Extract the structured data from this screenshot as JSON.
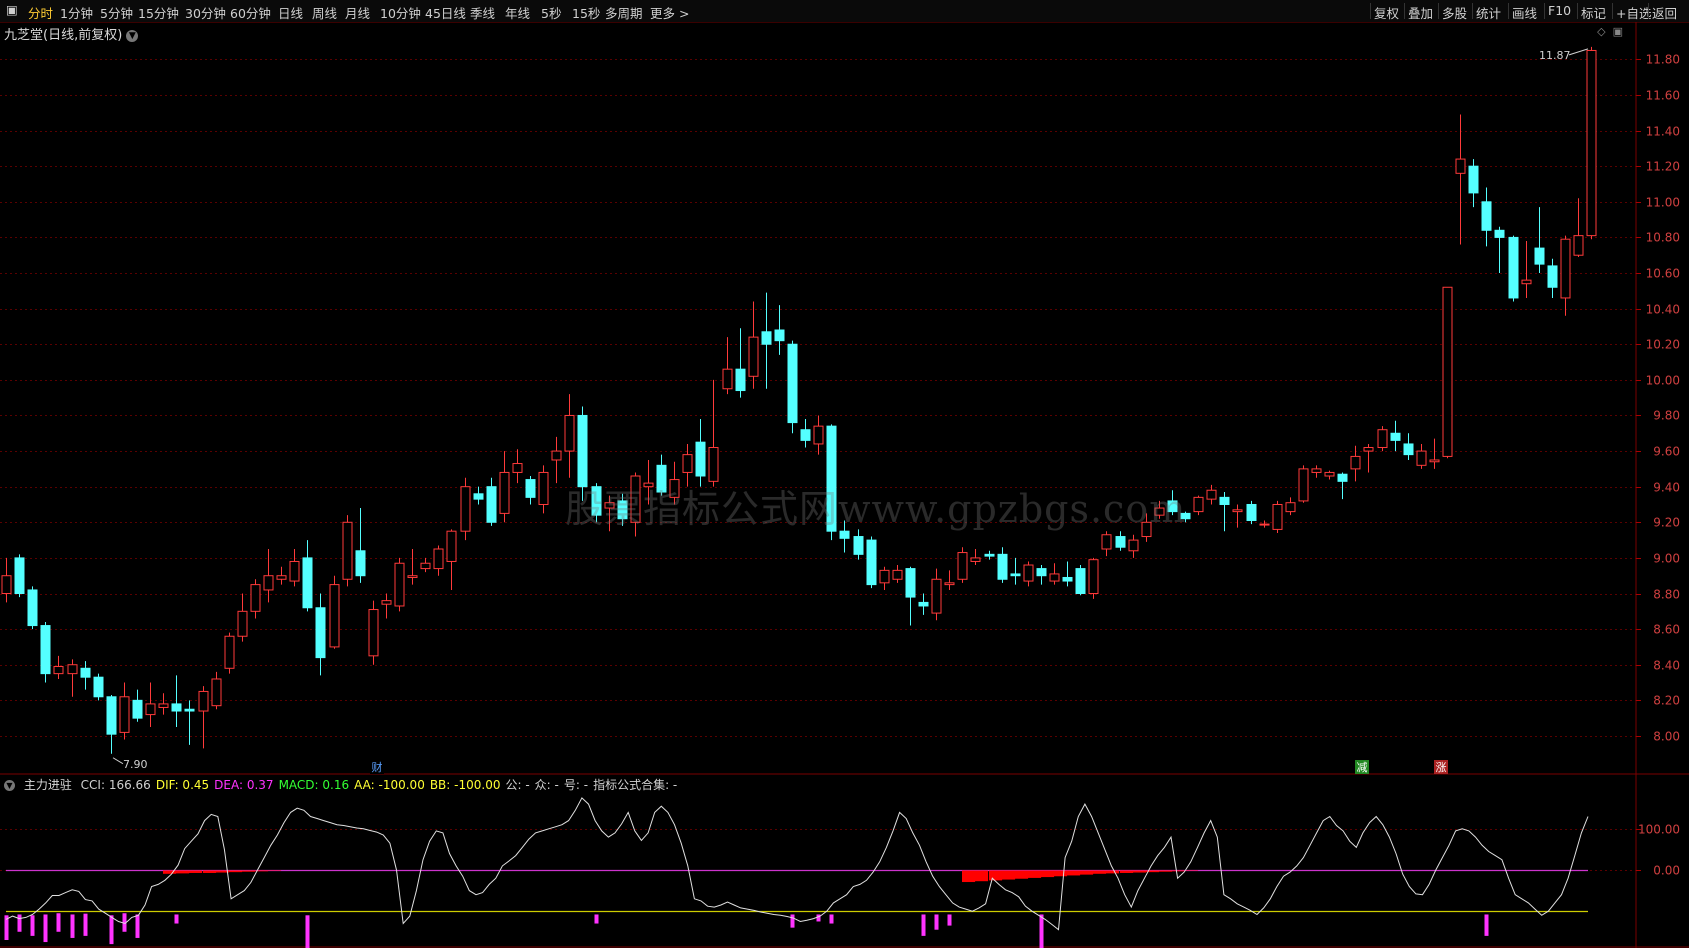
{
  "toolbar": {
    "tabs": [
      "分时",
      "1分钟",
      "5分钟",
      "15分钟",
      "30分钟",
      "60分钟",
      "日线",
      "周线",
      "月线",
      "10分钟",
      "45日线",
      "季线",
      "年线",
      "5秒",
      "15秒",
      "多周期",
      "更多 >"
    ],
    "active_tab": "分时",
    "right_buttons": [
      "复权",
      "叠加",
      "多股",
      "统计",
      "画线",
      "F10",
      "标记",
      "+自选",
      "返回"
    ]
  },
  "title": {
    "stock_name": "九芝堂",
    "period_label": "(日线,前复权)"
  },
  "watermark": "股票指标公式网www.gpzbgs.com",
  "markers": {
    "high_label": "11.87",
    "low_label": "7.90",
    "cai": "财",
    "jian": "减",
    "zhang": "涨"
  },
  "indicator": {
    "name": "主力进驻",
    "items": [
      {
        "label": "CCI: 166.66",
        "color": "#d0d0d0"
      },
      {
        "label": "DIF: 0.45",
        "color": "#ffff33"
      },
      {
        "label": "DEA: 0.37",
        "color": "#ff33ff"
      },
      {
        "label": "MACD: 0.16",
        "color": "#33ff33"
      },
      {
        "label": "AA: -100.00",
        "color": "#ffff33"
      },
      {
        "label": "BB: -100.00",
        "color": "#ffff33"
      },
      {
        "label": "公: -",
        "color": "#d0d0d0"
      },
      {
        "label": "众: -",
        "color": "#d0d0d0"
      },
      {
        "label": "号: -",
        "color": "#d0d0d0"
      },
      {
        "label": "指标公式合集: -",
        "color": "#d0d0d0"
      }
    ]
  },
  "colors": {
    "up": "#ff3a3a",
    "down": "#54ffff",
    "grid": "#5a0000",
    "cci_line": "#e0e0e0",
    "zero_line": "#cc33cc",
    "neg_line": "#cccc00",
    "red_bar": "#ff0000",
    "magenta_bar": "#ff33ff"
  },
  "chart_data": [
    {
      "type": "candlestick",
      "price_axis": {
        "ticks": [
          8.0,
          8.2,
          8.4,
          8.6,
          8.8,
          9.0,
          9.2,
          9.4,
          9.6,
          9.8,
          10.0,
          10.2,
          10.4,
          10.6,
          10.8,
          11.0,
          11.2,
          11.4,
          11.6,
          11.8
        ],
        "range": [
          7.82,
          11.92
        ]
      },
      "candles": [
        [
          8.8,
          8.9,
          8.75,
          9.0
        ],
        [
          9.0,
          8.8,
          8.78,
          9.02
        ],
        [
          8.82,
          8.62,
          8.6,
          8.84
        ],
        [
          8.62,
          8.35,
          8.3,
          8.64
        ],
        [
          8.35,
          8.39,
          8.32,
          8.45
        ],
        [
          8.35,
          8.4,
          8.22,
          8.43
        ],
        [
          8.38,
          8.33,
          8.26,
          8.42
        ],
        [
          8.33,
          8.22,
          8.2,
          8.35
        ],
        [
          8.22,
          8.01,
          7.9,
          8.23
        ],
        [
          8.02,
          8.22,
          7.98,
          8.3
        ],
        [
          8.2,
          8.1,
          8.08,
          8.26
        ],
        [
          8.12,
          8.18,
          8.05,
          8.3
        ],
        [
          8.16,
          8.18,
          8.12,
          8.24
        ],
        [
          8.18,
          8.14,
          8.05,
          8.34
        ],
        [
          8.15,
          8.14,
          7.95,
          8.2
        ],
        [
          8.14,
          8.25,
          7.93,
          8.28
        ],
        [
          8.17,
          8.32,
          8.15,
          8.36
        ],
        [
          8.38,
          8.56,
          8.35,
          8.58
        ],
        [
          8.56,
          8.7,
          8.53,
          8.8
        ],
        [
          8.7,
          8.85,
          8.66,
          8.88
        ],
        [
          8.82,
          8.9,
          8.75,
          9.05
        ],
        [
          8.88,
          8.9,
          8.85,
          8.95
        ],
        [
          8.87,
          8.98,
          8.84,
          9.05
        ],
        [
          9.0,
          8.72,
          8.7,
          9.1
        ],
        [
          8.72,
          8.44,
          8.34,
          8.8
        ],
        [
          8.5,
          8.85,
          8.49,
          8.9
        ],
        [
          8.88,
          9.2,
          8.84,
          9.24
        ],
        [
          9.04,
          8.9,
          8.86,
          9.28
        ],
        [
          8.45,
          8.71,
          8.4,
          8.76
        ],
        [
          8.74,
          8.76,
          8.66,
          8.8
        ],
        [
          8.73,
          8.97,
          8.7,
          9.0
        ],
        [
          8.89,
          8.9,
          8.85,
          9.05
        ],
        [
          8.94,
          8.97,
          8.92,
          9.0
        ],
        [
          8.94,
          9.05,
          8.9,
          9.07
        ],
        [
          8.98,
          9.15,
          8.82,
          9.16
        ],
        [
          9.15,
          9.4,
          9.1,
          9.45
        ],
        [
          9.36,
          9.33,
          9.3,
          9.4
        ],
        [
          9.4,
          9.2,
          9.18,
          9.45
        ],
        [
          9.25,
          9.48,
          9.2,
          9.6
        ],
        [
          9.48,
          9.53,
          9.42,
          9.61
        ],
        [
          9.44,
          9.34,
          9.3,
          9.46
        ],
        [
          9.3,
          9.48,
          9.25,
          9.52
        ],
        [
          9.55,
          9.6,
          9.42,
          9.68
        ],
        [
          9.6,
          9.8,
          9.45,
          9.92
        ],
        [
          9.8,
          9.4,
          9.32,
          9.85
        ],
        [
          9.4,
          9.24,
          9.2,
          9.42
        ],
        [
          9.28,
          9.31,
          9.15,
          9.35
        ],
        [
          9.32,
          9.22,
          9.18,
          9.36
        ],
        [
          9.2,
          9.46,
          9.12,
          9.48
        ],
        [
          9.4,
          9.42,
          9.3,
          9.55
        ],
        [
          9.52,
          9.37,
          9.35,
          9.58
        ],
        [
          9.34,
          9.44,
          9.3,
          9.54
        ],
        [
          9.48,
          9.58,
          9.4,
          9.64
        ],
        [
          9.65,
          9.46,
          9.4,
          9.78
        ],
        [
          9.43,
          9.62,
          9.4,
          10.0
        ],
        [
          9.95,
          10.06,
          9.92,
          10.24
        ],
        [
          10.06,
          9.94,
          9.9,
          10.29
        ],
        [
          10.02,
          10.24,
          9.95,
          10.44
        ],
        [
          10.27,
          10.2,
          9.95,
          10.49
        ],
        [
          10.28,
          10.22,
          10.14,
          10.42
        ],
        [
          10.2,
          9.76,
          9.7,
          10.22
        ],
        [
          9.72,
          9.66,
          9.62,
          9.78
        ],
        [
          9.64,
          9.74,
          9.58,
          9.8
        ],
        [
          9.74,
          9.15,
          9.1,
          9.75
        ],
        [
          9.15,
          9.11,
          9.03,
          9.21
        ],
        [
          9.12,
          9.02,
          8.99,
          9.16
        ],
        [
          9.1,
          8.85,
          8.83,
          9.12
        ],
        [
          8.86,
          8.93,
          8.82,
          8.95
        ],
        [
          8.88,
          8.93,
          8.86,
          8.96
        ],
        [
          8.94,
          8.78,
          8.62,
          8.95
        ],
        [
          8.75,
          8.73,
          8.68,
          8.8
        ],
        [
          8.69,
          8.88,
          8.65,
          8.94
        ],
        [
          8.85,
          8.86,
          8.82,
          8.93
        ],
        [
          8.88,
          9.03,
          8.86,
          9.06
        ],
        [
          8.98,
          9.0,
          8.96,
          9.05
        ],
        [
          9.02,
          9.01,
          8.99,
          9.04
        ],
        [
          9.02,
          8.88,
          8.86,
          9.06
        ],
        [
          8.91,
          8.9,
          8.85,
          9.0
        ],
        [
          8.87,
          8.96,
          8.84,
          8.98
        ],
        [
          8.94,
          8.9,
          8.85,
          8.96
        ],
        [
          8.87,
          8.91,
          8.85,
          8.97
        ],
        [
          8.89,
          8.87,
          8.84,
          8.98
        ],
        [
          8.94,
          8.8,
          8.79,
          8.96
        ],
        [
          8.8,
          8.99,
          8.77,
          9.0
        ],
        [
          9.05,
          9.13,
          9.01,
          9.15
        ],
        [
          9.12,
          9.06,
          9.04,
          9.15
        ],
        [
          9.04,
          9.1,
          9.0,
          9.13
        ],
        [
          9.12,
          9.2,
          9.09,
          9.25
        ],
        [
          9.24,
          9.28,
          9.22,
          9.32
        ],
        [
          9.32,
          9.26,
          9.24,
          9.38
        ],
        [
          9.25,
          9.22,
          9.2,
          9.26
        ],
        [
          9.26,
          9.34,
          9.24,
          9.35
        ],
        [
          9.33,
          9.38,
          9.3,
          9.41
        ],
        [
          9.34,
          9.3,
          9.15,
          9.37
        ],
        [
          9.26,
          9.27,
          9.17,
          9.3
        ],
        [
          9.3,
          9.21,
          9.19,
          9.32
        ],
        [
          9.19,
          9.19,
          9.17,
          9.21
        ],
        [
          9.16,
          9.3,
          9.14,
          9.32
        ],
        [
          9.26,
          9.31,
          9.24,
          9.34
        ],
        [
          9.32,
          9.5,
          9.31,
          9.52
        ],
        [
          9.48,
          9.5,
          9.45,
          9.52
        ],
        [
          9.46,
          9.48,
          9.44,
          9.49
        ],
        [
          9.47,
          9.43,
          9.33,
          9.48
        ],
        [
          9.5,
          9.57,
          9.43,
          9.63
        ],
        [
          9.6,
          9.62,
          9.48,
          9.64
        ],
        [
          9.62,
          9.72,
          9.6,
          9.74
        ],
        [
          9.7,
          9.66,
          9.6,
          9.77
        ],
        [
          9.64,
          9.58,
          9.55,
          9.7
        ],
        [
          9.52,
          9.6,
          9.5,
          9.64
        ],
        [
          9.54,
          9.55,
          9.5,
          9.67
        ],
        [
          9.57,
          10.52,
          9.56,
          10.52
        ],
        [
          11.16,
          11.24,
          10.76,
          11.49
        ],
        [
          11.2,
          11.05,
          10.97,
          11.24
        ],
        [
          11.0,
          10.84,
          10.75,
          11.08
        ],
        [
          10.84,
          10.8,
          10.6,
          10.86
        ],
        [
          10.8,
          10.46,
          10.44,
          10.81
        ],
        [
          10.54,
          10.56,
          10.46,
          10.78
        ],
        [
          10.74,
          10.65,
          10.6,
          10.97
        ],
        [
          10.64,
          10.52,
          10.46,
          10.68
        ],
        [
          10.46,
          10.79,
          10.36,
          10.81
        ],
        [
          10.7,
          10.81,
          10.69,
          11.02
        ],
        [
          10.81,
          11.85,
          10.79,
          11.87
        ]
      ]
    },
    {
      "type": "line",
      "name": "CCI",
      "y_axis": {
        "ticks": [
          100.0,
          0.0
        ],
        "range": [
          -170,
          170
        ]
      },
      "values": [
        -120,
        -112,
        -118,
        -115,
        -108,
        -95,
        -80,
        -62,
        -62,
        -55,
        -48,
        -52,
        -72,
        -75,
        -95,
        -105,
        -115,
        -125,
        -130,
        -115,
        -110,
        -85,
        -40,
        -35,
        -25,
        -10,
        12,
        52,
        70,
        88,
        120,
        135,
        130,
        50,
        -70,
        -60,
        -50,
        -30,
        0,
        30,
        60,
        85,
        115,
        140,
        150,
        145,
        130,
        125,
        120,
        115,
        110,
        108,
        105,
        102,
        100,
        96,
        92,
        85,
        65,
        0,
        -130,
        -112,
        -50,
        25,
        70,
        95,
        90,
        40,
        10,
        -15,
        -50,
        -60,
        -55,
        -35,
        -20,
        10,
        22,
        35,
        55,
        75,
        90,
        95,
        100,
        105,
        110,
        120,
        145,
        175,
        160,
        120,
        95,
        80,
        90,
        112,
        140,
        95,
        72,
        90,
        140,
        155,
        140,
        110,
        65,
        10,
        -70,
        -75,
        -88,
        -90,
        -85,
        -78,
        -85,
        -92,
        -95,
        -98,
        -102,
        -105,
        -108,
        -110,
        -113,
        -117,
        -125,
        -122,
        -118,
        -112,
        -100,
        -80,
        -70,
        -60,
        -40,
        -35,
        -25,
        -5,
        20,
        55,
        95,
        140,
        125,
        90,
        60,
        20,
        -15,
        -40,
        -60,
        -80,
        -90,
        -95,
        -100,
        -92,
        -82,
        -20,
        -35,
        -48,
        -55,
        -65,
        -88,
        -100,
        -110,
        -120,
        -132,
        -145,
        30,
        70,
        130,
        160,
        130,
        90,
        50,
        10,
        -20,
        -60,
        -90,
        -50,
        -20,
        10,
        35,
        55,
        80,
        -20,
        -5,
        20,
        55,
        90,
        120,
        80,
        -60,
        -70,
        -82,
        -90,
        -98,
        -108,
        -92,
        -70,
        -40,
        -15,
        -5,
        10,
        30,
        60,
        90,
        120,
        130,
        108,
        95,
        70,
        55,
        90,
        115,
        130,
        110,
        80,
        40,
        -10,
        -40,
        -58,
        -60,
        -35,
        0,
        30,
        60,
        95,
        100,
        95,
        80,
        60,
        45,
        35,
        25,
        -20,
        -60,
        -70,
        -80,
        -95,
        -110,
        -100,
        -80,
        -60,
        -20,
        35,
        90,
        130
      ],
      "bars_red_macd": [
        [
          12,
          -8
        ],
        [
          13,
          -7
        ],
        [
          14,
          -6
        ],
        [
          15,
          -6
        ],
        [
          16,
          -5
        ],
        [
          17,
          -4
        ],
        [
          18,
          -3
        ],
        [
          19,
          -2
        ],
        [
          20,
          -1
        ],
        [
          73,
          -28
        ],
        [
          74,
          -26
        ],
        [
          75,
          -24
        ],
        [
          76,
          -22
        ],
        [
          77,
          -20
        ],
        [
          78,
          -18
        ],
        [
          79,
          -16
        ],
        [
          80,
          -14
        ],
        [
          81,
          -12
        ],
        [
          82,
          -10
        ],
        [
          83,
          -8
        ],
        [
          84,
          -7
        ],
        [
          85,
          -6
        ],
        [
          86,
          -5
        ],
        [
          87,
          -4
        ],
        [
          88,
          -3
        ],
        [
          89,
          -2
        ],
        [
          90,
          -1
        ]
      ],
      "bars_magenta": [
        [
          0,
          -110,
          -170
        ],
        [
          1,
          -108,
          -150
        ],
        [
          2,
          -110,
          -160
        ],
        [
          3,
          -108,
          -175
        ],
        [
          4,
          -105,
          -150
        ],
        [
          5,
          -108,
          -165
        ],
        [
          6,
          -106,
          -160
        ],
        [
          8,
          -110,
          -180
        ],
        [
          9,
          -105,
          -150
        ],
        [
          10,
          -108,
          -165
        ],
        [
          13,
          -108,
          -130
        ],
        [
          23,
          -110,
          -200
        ],
        [
          45,
          -108,
          -130
        ],
        [
          60,
          -108,
          -140
        ],
        [
          62,
          -108,
          -125
        ],
        [
          63,
          -108,
          -130
        ],
        [
          70,
          -108,
          -160
        ],
        [
          71,
          -108,
          -145
        ],
        [
          72,
          -108,
          -135
        ],
        [
          79,
          -108,
          -200
        ],
        [
          113,
          -108,
          -160
        ]
      ]
    }
  ]
}
